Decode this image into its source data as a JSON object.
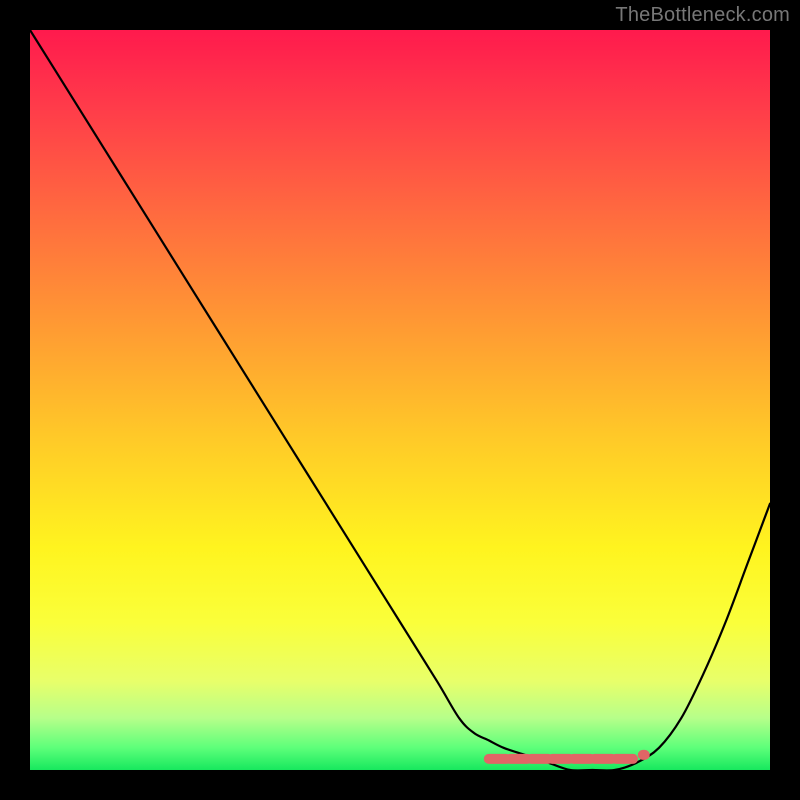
{
  "attribution": "TheBottleneck.com",
  "chart_data": {
    "type": "line",
    "title": "",
    "xlabel": "",
    "ylabel": "",
    "ylim": [
      0,
      100
    ],
    "x": [
      0.0,
      0.05,
      0.1,
      0.15,
      0.2,
      0.25,
      0.3,
      0.35,
      0.4,
      0.45,
      0.5,
      0.55,
      0.58,
      0.6,
      0.62,
      0.64,
      0.67,
      0.7,
      0.73,
      0.76,
      0.79,
      0.82,
      0.85,
      0.88,
      0.91,
      0.94,
      0.97,
      1.0
    ],
    "values": [
      100,
      92,
      84,
      76,
      68,
      60,
      52,
      44,
      36,
      28,
      20,
      12,
      7,
      5,
      4,
      3,
      2,
      1,
      0,
      0,
      0,
      1,
      3,
      7,
      13,
      20,
      28,
      36
    ],
    "valley_highlight": {
      "x_start": 0.62,
      "x_end": 0.82,
      "y": 1.5,
      "color": "#e06666"
    },
    "curve_color": "#000000",
    "background": "gradient-bottleneck"
  }
}
